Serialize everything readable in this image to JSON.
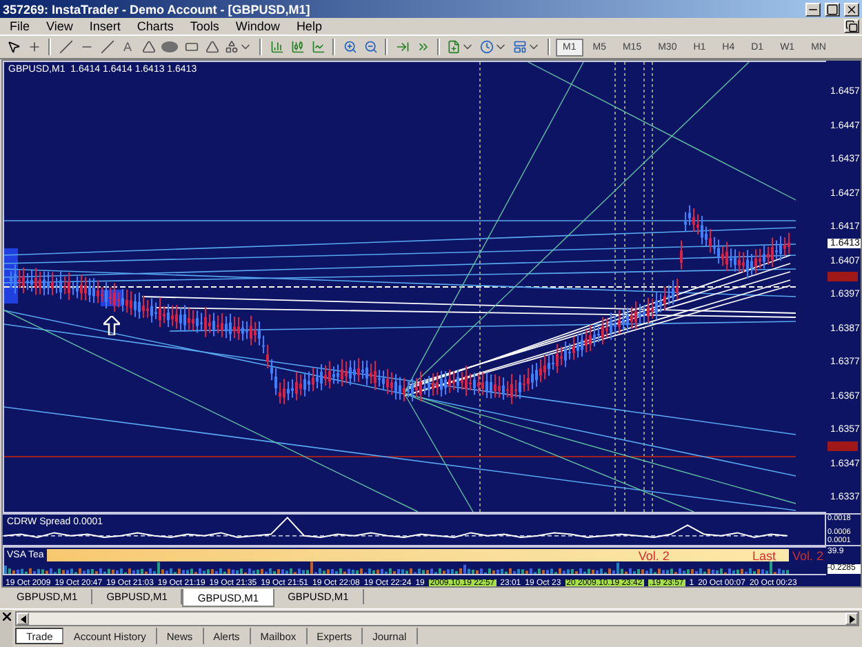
{
  "window": {
    "title": "357269: InstaTrader - Demo Account - [GBPUSD,M1]"
  },
  "menu": [
    "File",
    "View",
    "Insert",
    "Charts",
    "Tools",
    "Window",
    "Help"
  ],
  "toolbar": {
    "text_tool": "A",
    "timeframes": [
      {
        "label": "M1",
        "selected": true
      },
      {
        "label": "M5",
        "selected": false
      },
      {
        "label": "M15",
        "selected": false
      },
      {
        "label": "M30",
        "selected": false
      },
      {
        "label": "H1",
        "selected": false
      },
      {
        "label": "H4",
        "selected": false
      },
      {
        "label": "D1",
        "selected": false
      },
      {
        "label": "W1",
        "selected": false
      },
      {
        "label": "MN",
        "selected": false
      }
    ]
  },
  "chart": {
    "header": "GBPUSD,M1  1.6414 1.6414 1.6413 1.6413",
    "price_axis": [
      "1.6457",
      "1.6447",
      "1.6437",
      "1.6427",
      "1.6417",
      "1.6407",
      "1.6397",
      "1.6387",
      "1.6377",
      "1.6367",
      "1.6357",
      "1.6347",
      "1.6337"
    ],
    "current_price": "1.6413",
    "time_axis": [
      {
        "text": "19 Oct 2009",
        "kind": "label"
      },
      {
        "text": "19 Oct 20:47",
        "kind": "label"
      },
      {
        "text": "19 Oct 21:03",
        "kind": "label"
      },
      {
        "text": "19 Oct 21:19",
        "kind": "label"
      },
      {
        "text": "19 Oct 21:35",
        "kind": "label"
      },
      {
        "text": "19 Oct 21:51",
        "kind": "label"
      },
      {
        "text": "19 Oct 22:08",
        "kind": "label"
      },
      {
        "text": "19 Oct 22:24",
        "kind": "label"
      },
      {
        "text": "19",
        "kind": "label"
      },
      {
        "text": "2009.10.19 22:57",
        "kind": "tag"
      },
      {
        "text": "23:01",
        "kind": "label"
      },
      {
        "text": "19 Oct 23",
        "kind": "label"
      },
      {
        "text": "20 2009.10.19 23:42",
        "kind": "tag"
      },
      {
        "text": ".19 23:57",
        "kind": "tag"
      },
      {
        "text": "1",
        "kind": "label"
      },
      {
        "text": "20 Oct 00:07",
        "kind": "label"
      },
      {
        "text": "20 Oct 00:23",
        "kind": "label"
      }
    ]
  },
  "cdrw": {
    "title": "CDRW Spread 0.0001",
    "chart_data": {
      "type": "line",
      "ylim": [
        0,
        0.002
      ],
      "yticks": [
        {
          "value": 0.0018,
          "label": "0.0018"
        },
        {
          "value": 0.0006,
          "label": "0.0006"
        },
        {
          "value": 0.0001,
          "label": "0.0001"
        }
      ],
      "series": [
        {
          "color": "#ffffff",
          "values": [
            0.0006,
            0.0007,
            0.0005,
            0.0008,
            0.0006,
            0.0007,
            0.0005,
            0.0006,
            0.0008,
            0.0006,
            0.0005,
            0.0007,
            0.0006,
            0.0008,
            0.0005,
            0.0006,
            0.0007,
            0.0018,
            0.0006,
            0.0005,
            0.0007,
            0.0006,
            0.0008,
            0.0006,
            0.0005,
            0.0007,
            0.0006,
            0.0005,
            0.0008,
            0.0006,
            0.0007,
            0.0005,
            0.0006,
            0.0008,
            0.0007,
            0.0005,
            0.0006,
            0.0007,
            0.0006,
            0.0005,
            0.0007,
            0.0013,
            0.0007,
            0.0006,
            0.0008,
            0.0005,
            0.0007,
            0.0006
          ]
        }
      ]
    }
  },
  "vsa": {
    "title": "VSA Tea",
    "band_texts": [
      "Vol. 2",
      "Last"
    ],
    "outside_text": "Vol. 2",
    "axis": [
      "39.9",
      "-0.2285"
    ]
  },
  "chart_tabs": [
    {
      "label": "GBPUSD,M1",
      "selected": false
    },
    {
      "label": "GBPUSD,M1",
      "selected": false
    },
    {
      "label": "GBPUSD,M1",
      "selected": true
    },
    {
      "label": "GBPUSD,M1",
      "selected": false
    }
  ],
  "terminal_tabs": [
    {
      "label": "Trade",
      "selected": true
    },
    {
      "label": "Account History",
      "selected": false
    },
    {
      "label": "News",
      "selected": false
    },
    {
      "label": "Alerts",
      "selected": false
    },
    {
      "label": "Mailbox",
      "selected": false
    },
    {
      "label": "Experts",
      "selected": false
    },
    {
      "label": "Journal",
      "selected": false
    }
  ]
}
